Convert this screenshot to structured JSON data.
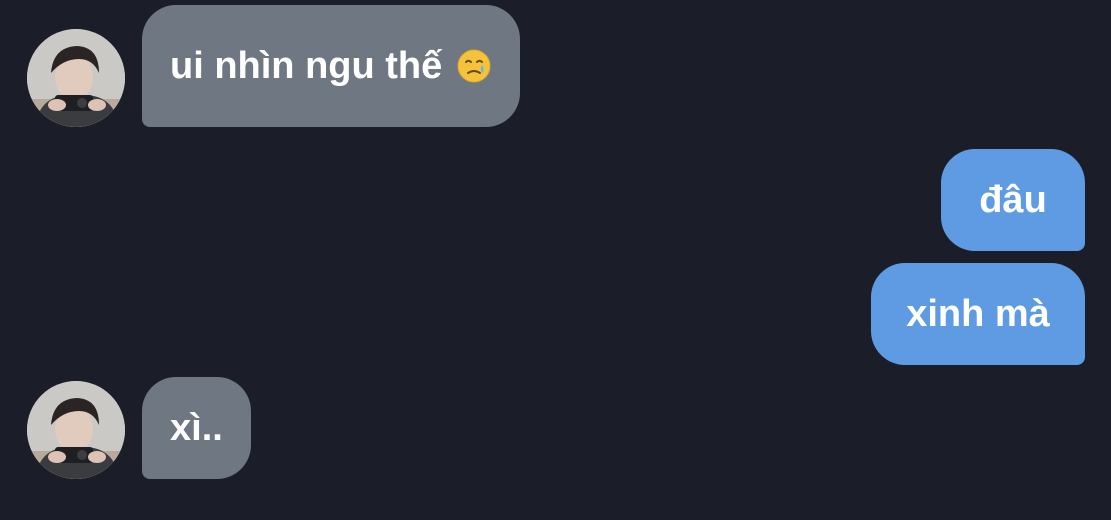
{
  "conversation": {
    "messages": [
      {
        "sender": "other",
        "text": "ui nhìn ngu thế",
        "emoji": "smiling-face-with-tear"
      },
      {
        "sender": "me",
        "text": "đâu"
      },
      {
        "sender": "me",
        "text": "xinh mà"
      },
      {
        "sender": "other",
        "text": "xì.."
      }
    ]
  },
  "colors": {
    "background": "#1b1e29",
    "incoming_bubble": "#6f7783",
    "outgoing_bubble": "#5e9be3",
    "text": "#ffffff"
  }
}
